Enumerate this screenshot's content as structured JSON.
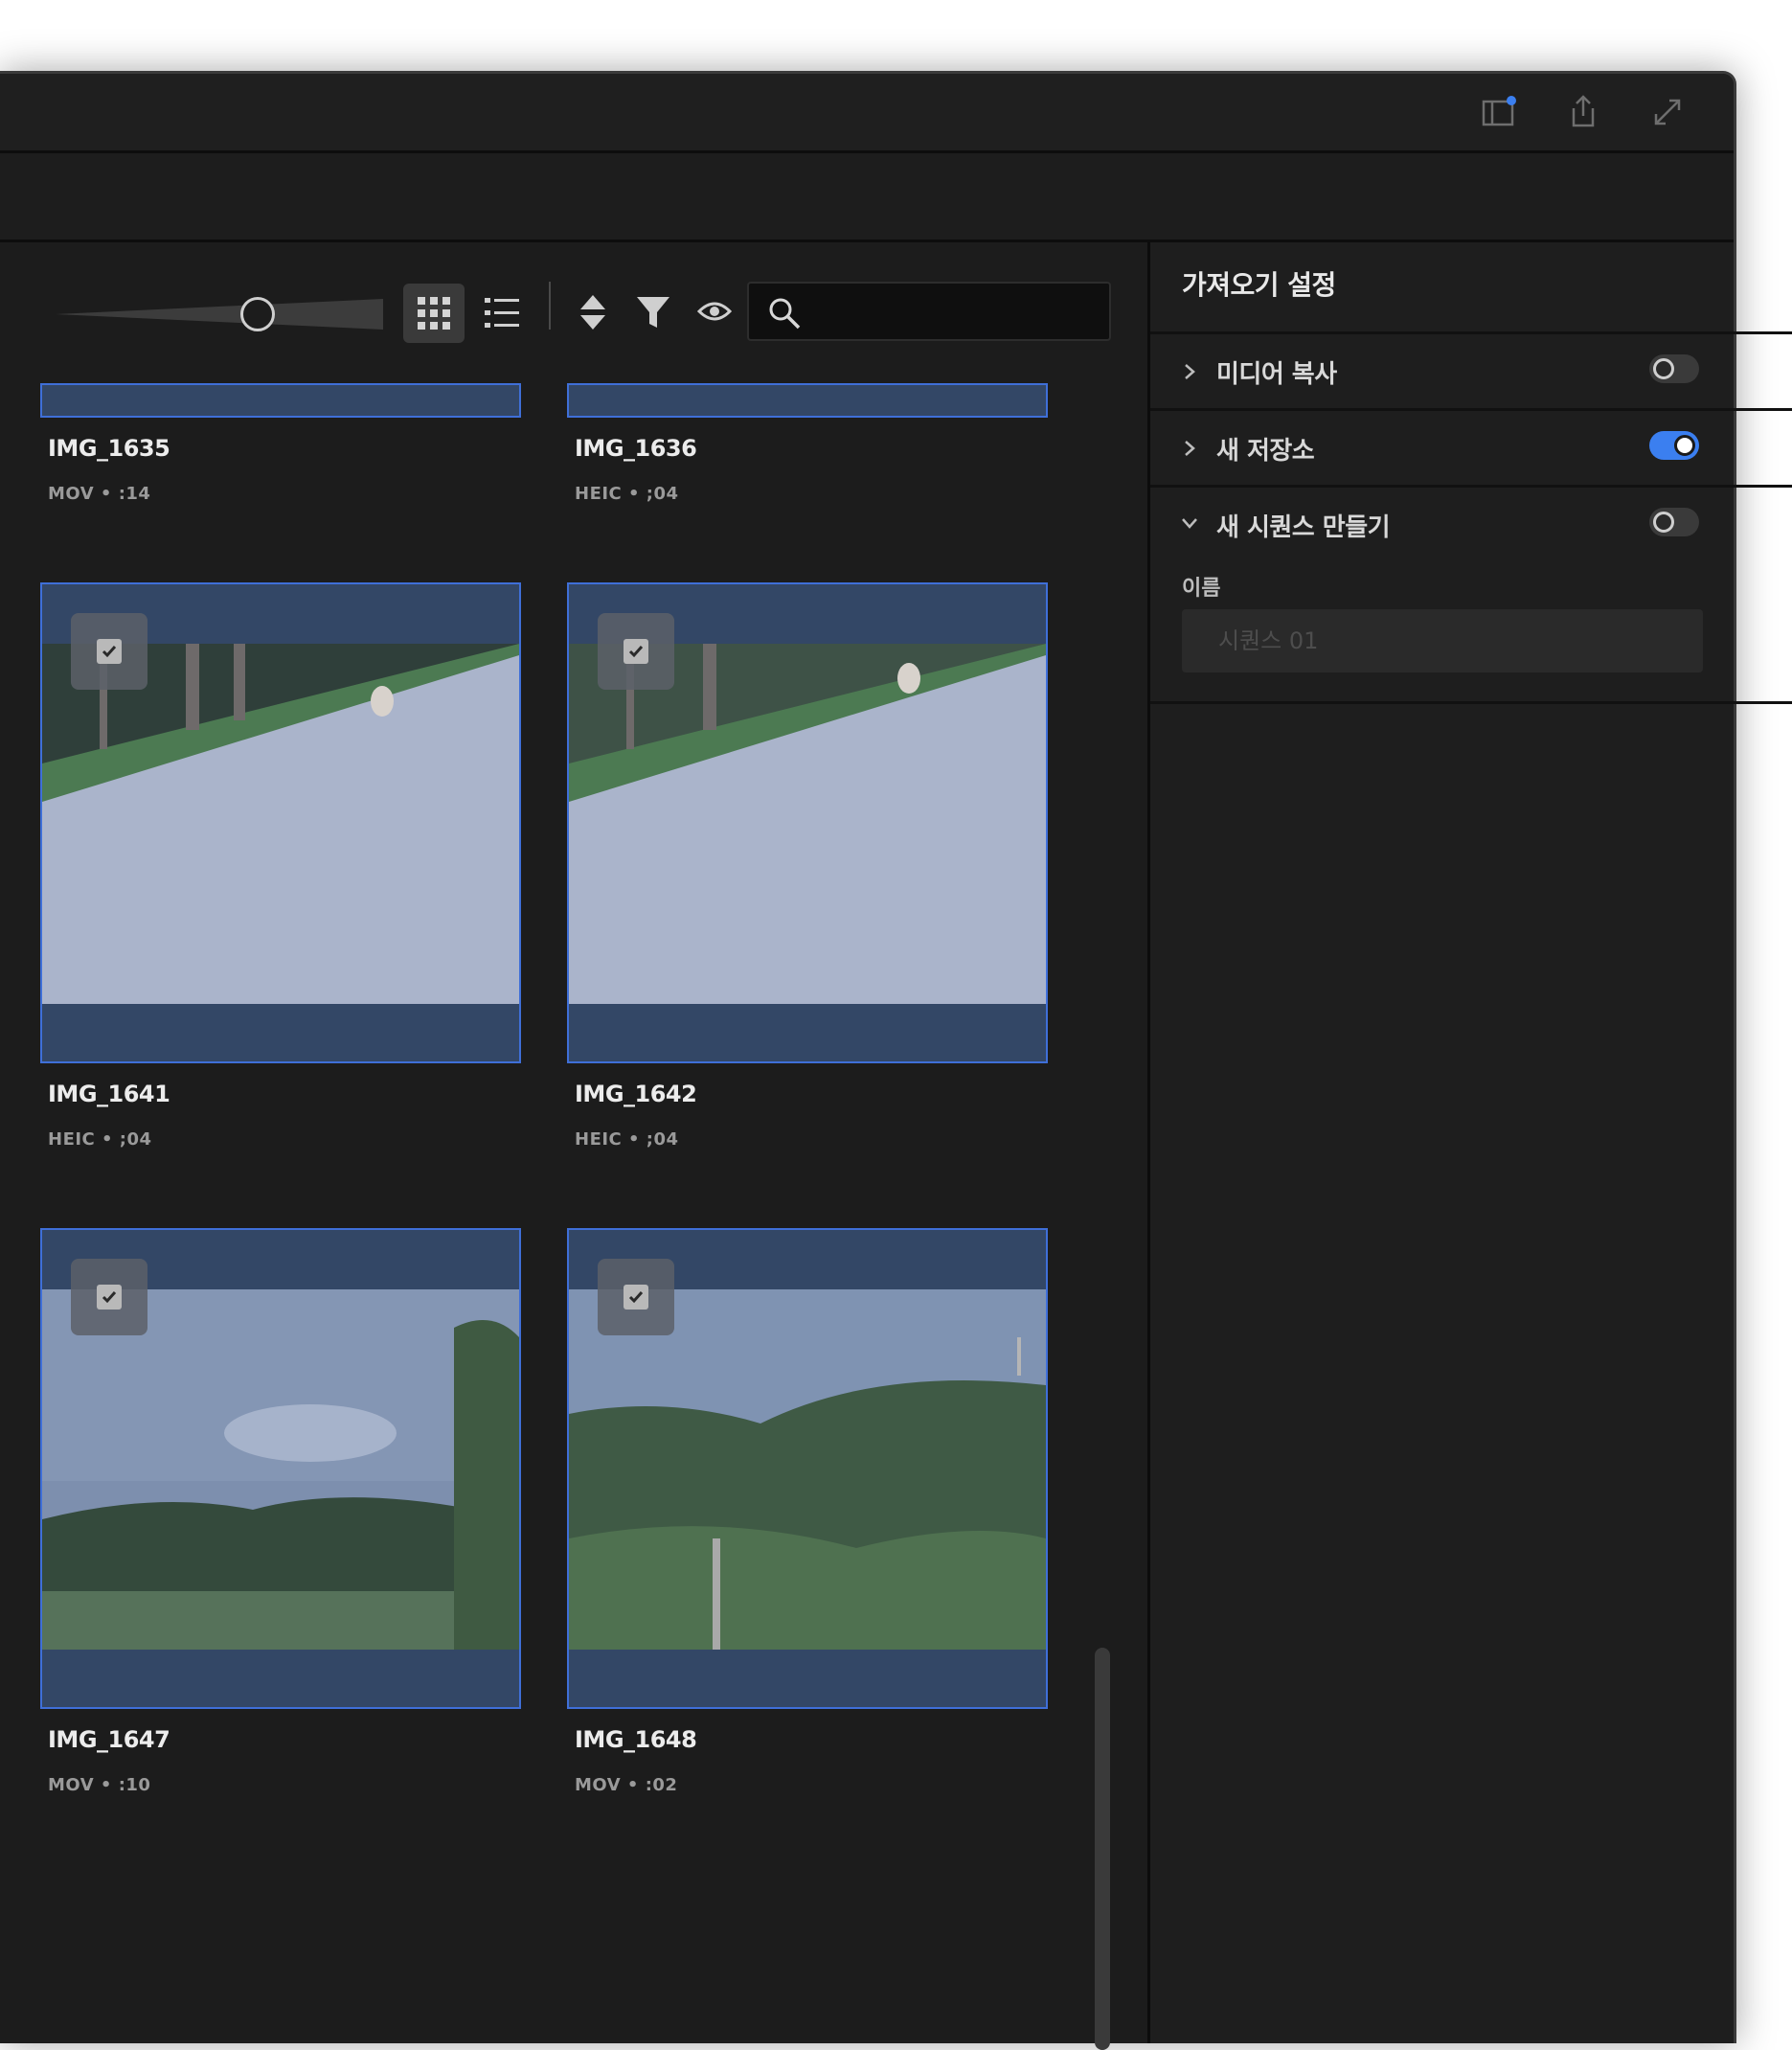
{
  "window": {
    "titlebar_icons": [
      "panel-notification-icon",
      "share-icon",
      "expand-icon"
    ]
  },
  "browser": {
    "view_buttons": [
      "grid-view-icon",
      "list-view-icon"
    ],
    "tool_icons": [
      "sort-icon",
      "filter-icon",
      "eye-icon",
      "search-icon"
    ],
    "search": {
      "value": "",
      "placeholder": ""
    },
    "items": [
      {
        "name": "IMG_1635",
        "meta": "MOV • :14"
      },
      {
        "name": "IMG_1636",
        "meta": "HEIC • ;04"
      },
      {
        "name": "IMG_1641",
        "meta": "HEIC • ;04"
      },
      {
        "name": "IMG_1642",
        "meta": "HEIC • ;04"
      },
      {
        "name": "IMG_1647",
        "meta": "MOV • :10"
      },
      {
        "name": "IMG_1648",
        "meta": "MOV • :02"
      }
    ]
  },
  "settings": {
    "title": "가져오기 설정",
    "rows": [
      {
        "label": "미디어 복사",
        "expanded": false,
        "toggle": "off"
      },
      {
        "label": "새 저장소",
        "expanded": false,
        "toggle": "on"
      },
      {
        "label": "새 시퀀스 만들기",
        "expanded": true,
        "toggle": "off"
      }
    ],
    "name_label": "이름",
    "name_placeholder": "시퀀스 01"
  },
  "colors": {
    "accent": "#3b7ff0",
    "tile_bg": "#334766",
    "tile_border": "#3f6fd8",
    "window_bg": "#1c1c1c"
  }
}
